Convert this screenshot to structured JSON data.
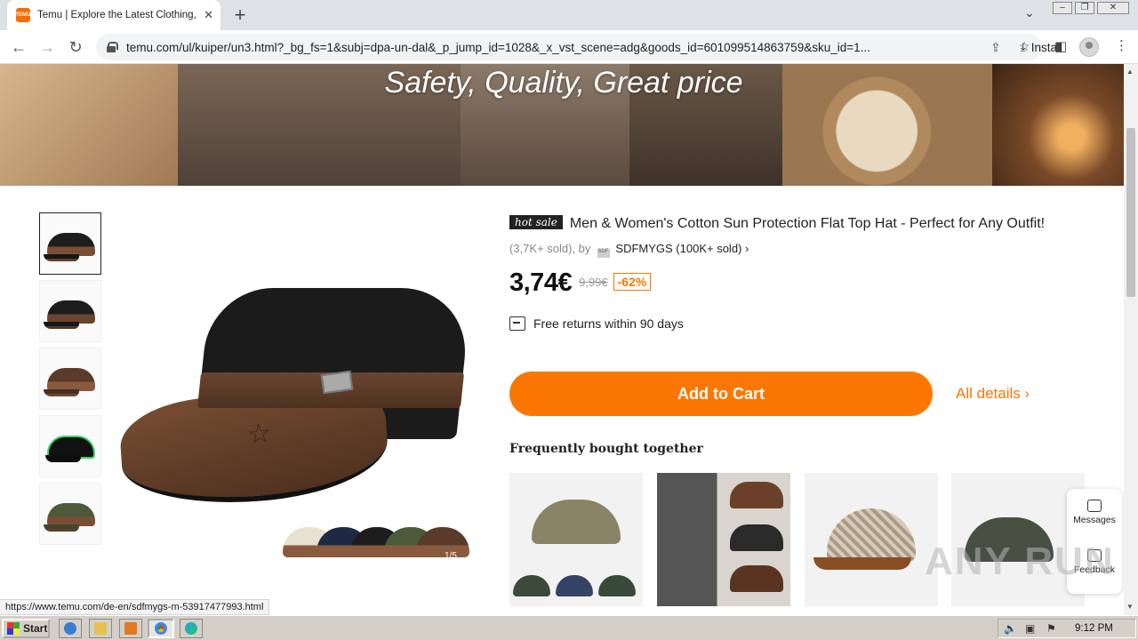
{
  "browser": {
    "tab_title": "Temu | Explore the Latest Clothing, B",
    "tab_favicon_text": "TEMU",
    "url": "temu.com/ul/kuiper/un3.html?_bg_fs=1&subj=dpa-un-dal&_p_jump_id=1028&_x_vst_scene=adg&goods_id=601099514863759&sku_id=1...",
    "install_label": "Install",
    "status_url": "https://www.temu.com/de-en/sdfmygs-m-53917477993.html"
  },
  "banner": {
    "tagline": "Safety, Quality, Great price"
  },
  "product": {
    "hot_sale_label": "hot sale",
    "title": "Men & Women's Cotton Sun Protection Flat Top Hat - Perfect for Any Outfit!",
    "sold_prefix": "(3,7K+ sold), by",
    "seller_logo_text": "SDF",
    "seller": "SDFMYGS (100K+ sold)",
    "price": "3,74€",
    "old_price": "9,99€",
    "discount": "-62%",
    "returns": "Free returns within 90 days",
    "add_to_cart": "Add to Cart",
    "all_details": "All details",
    "image_counter": "1/5",
    "thumbnail_count": 5
  },
  "frequently_bought": {
    "title": "Frequently bought together",
    "items": [
      "olive-military-cap",
      "leather-flat-caps",
      "houndstooth-baseball-cap",
      "grey-military-cap"
    ]
  },
  "side_panel": {
    "messages": "Messages",
    "feedback": "Feedback"
  },
  "watermark": "ANY RUN",
  "taskbar": {
    "start": "Start",
    "clock": "9:12 PM"
  },
  "colors": {
    "accent": "#fb7701",
    "text": "#222222"
  }
}
